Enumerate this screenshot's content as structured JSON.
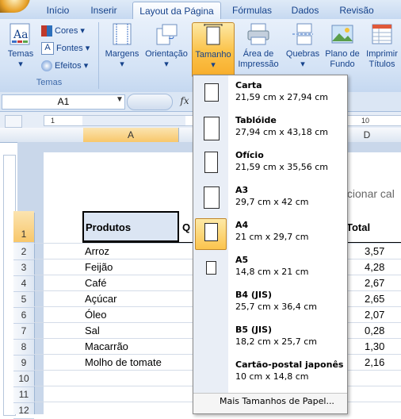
{
  "tabs": [
    {
      "label": "Início",
      "active": false
    },
    {
      "label": "Inserir",
      "active": false
    },
    {
      "label": "Layout da Página",
      "active": true
    },
    {
      "label": "Fórmulas",
      "active": false
    },
    {
      "label": "Dados",
      "active": false
    },
    {
      "label": "Revisão",
      "active": false
    }
  ],
  "ribbon": {
    "temas": {
      "label": "Temas",
      "group": "Temas",
      "cores": "Cores",
      "fontes": "Fontes",
      "efeitos": "Efeitos"
    },
    "margens": "Margens",
    "orientacao": "Orientação",
    "tamanho": "Tamanho",
    "area": [
      "Área de",
      "Impressão"
    ],
    "quebras": "Quebras",
    "plano": [
      "Plano de",
      "Fundo"
    ],
    "imprimir": [
      "Imprimir",
      "Títulos"
    ]
  },
  "formula_bar": {
    "name_box": "A1",
    "fx": "fx"
  },
  "columns": {
    "a": "A",
    "d": "D"
  },
  "hint": "dicionar cal",
  "sheet": {
    "header": {
      "produtos": "Produtos",
      "q": "Q",
      "total": "Total"
    },
    "rows": [
      {
        "num": "1",
        "name": "",
        "total": ""
      },
      {
        "num": "2",
        "name": "Arroz",
        "total": "3,57"
      },
      {
        "num": "3",
        "name": "Feijão",
        "total": "4,28"
      },
      {
        "num": "4",
        "name": "Café",
        "total": "2,67"
      },
      {
        "num": "5",
        "name": "Açúcar",
        "total": "2,65"
      },
      {
        "num": "6",
        "name": "Óleo",
        "total": "2,07"
      },
      {
        "num": "7",
        "name": "Sal",
        "total": "0,28"
      },
      {
        "num": "8",
        "name": "Macarrão",
        "total": "1,30"
      },
      {
        "num": "9",
        "name": "Molho de tomate",
        "total": "2,16"
      },
      {
        "num": "10",
        "name": "",
        "total": ""
      },
      {
        "num": "11",
        "name": "",
        "total": ""
      },
      {
        "num": "12",
        "name": "",
        "total": ""
      }
    ]
  },
  "paper_sizes": [
    {
      "name": "Carta",
      "size": "21,59 cm x 27,94 cm",
      "selected": false
    },
    {
      "name": "Tablóide",
      "size": "27,94 cm x 43,18 cm",
      "selected": false
    },
    {
      "name": "Ofício",
      "size": "21,59 cm x 35,56 cm",
      "selected": false
    },
    {
      "name": "A3",
      "size": "29,7 cm x 42 cm",
      "selected": false
    },
    {
      "name": "A4",
      "size": "21 cm x 29,7 cm",
      "selected": true
    },
    {
      "name": "A5",
      "size": "14,8 cm x 21 cm",
      "selected": false
    },
    {
      "name": "B4 (JIS)",
      "size": "25,7 cm x 36,4 cm",
      "selected": false
    },
    {
      "name": "B5 (JIS)",
      "size": "18,2 cm x 25,7 cm",
      "selected": false
    },
    {
      "name": "Cartão-postal japonês",
      "size": "10 cm x 14,8 cm",
      "selected": false
    }
  ],
  "more_sizes": "Mais Tamanhos de Papel..."
}
